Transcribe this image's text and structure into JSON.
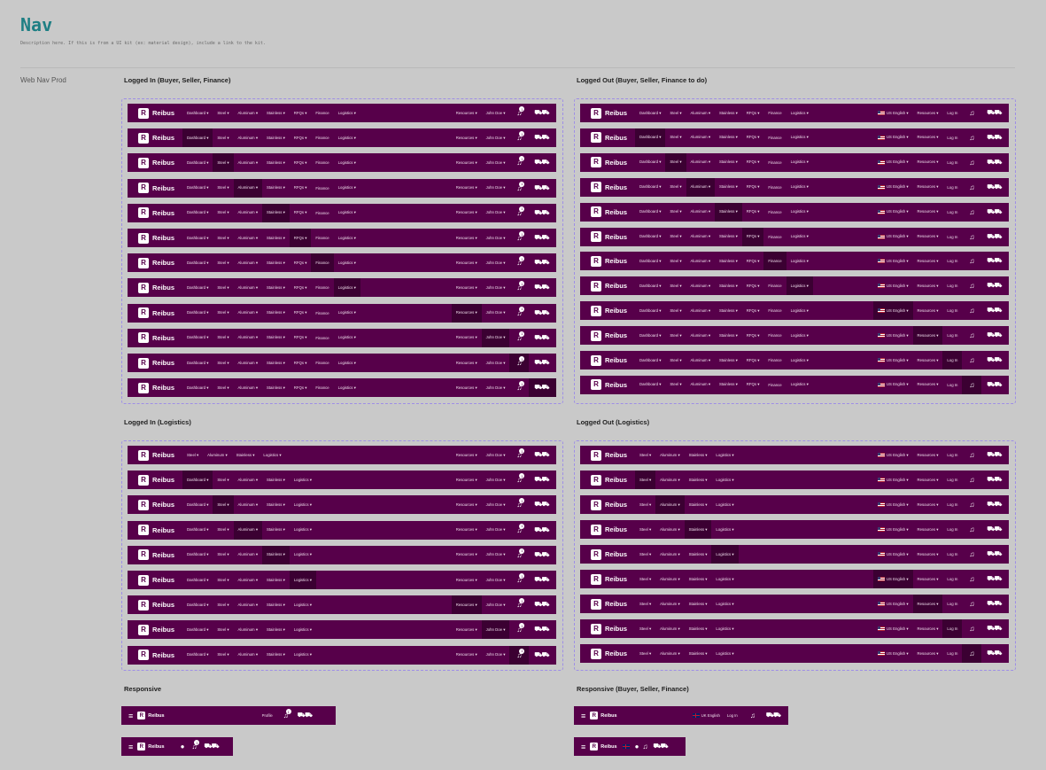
{
  "page": {
    "title": "Nav",
    "description": "Description here. If this is from a UI kit (ex: material design), include a link to the kit.",
    "side_label": "Web Nav Prod"
  },
  "sections": {
    "li": "Logged In (Buyer, Seller, Finance)",
    "lo": "Logged Out (Buyer, Seller, Finance to do)",
    "lil": "Logged In (Logistics)",
    "lol": "Logged Out (Logistics)",
    "resp": "Responsive",
    "resp2": "Responsive (Buyer, Seller, Finance)"
  },
  "brand": {
    "name": "Reibus",
    "logo": "R"
  },
  "nav": {
    "dashboard": "Dashboard ▾",
    "steel": "Steel ▾",
    "aluminum": "Aluminum ▾",
    "stainless": "Stainless ▾",
    "rfqs": "RFQs ▾",
    "finance": "Finance",
    "logistics": "Logistics ▾",
    "resources": "Resources ▾",
    "user": "John Doe ▾",
    "language": "US English ▾",
    "login": "Log In",
    "notification_count": "1"
  },
  "responsive": {
    "profile": "Profile",
    "uk_english": "UK English",
    "login": "Log In"
  },
  "colors": {
    "nav_bg": "#57004a",
    "nav_hover": "#3b0032",
    "title": "#1e7f84",
    "frame": "#9e8ee6"
  },
  "icons": {
    "menu": "hamburger-icon",
    "bell": "bell-icon",
    "truck": "truck-icon",
    "user": "user-icon",
    "flag_us": "us-flag-icon",
    "flag_uk": "uk-flag-icon"
  }
}
